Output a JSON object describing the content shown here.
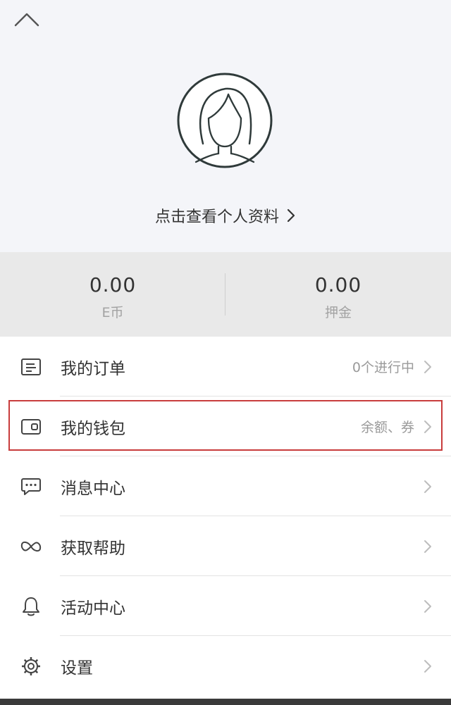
{
  "profile": {
    "view_profile_label": "点击查看个人资料",
    "background_color": "#f4f5f9"
  },
  "stats": [
    {
      "value": "0.00",
      "label": "E币"
    },
    {
      "value": "0.00",
      "label": "押金"
    }
  ],
  "menu": [
    {
      "icon": "order-list-icon",
      "label": "我的订单",
      "status": "0个进行中"
    },
    {
      "icon": "wallet-icon",
      "label": "我的钱包",
      "status": "余额、券"
    },
    {
      "icon": "message-icon",
      "label": "消息中心",
      "status": ""
    },
    {
      "icon": "help-icon",
      "label": "获取帮助",
      "status": ""
    },
    {
      "icon": "bell-icon",
      "label": "活动中心",
      "status": ""
    },
    {
      "icon": "gear-icon",
      "label": "设置",
      "status": ""
    }
  ],
  "colors": {
    "highlight": "#c83c3c",
    "stats_background": "#e9e9e9"
  }
}
